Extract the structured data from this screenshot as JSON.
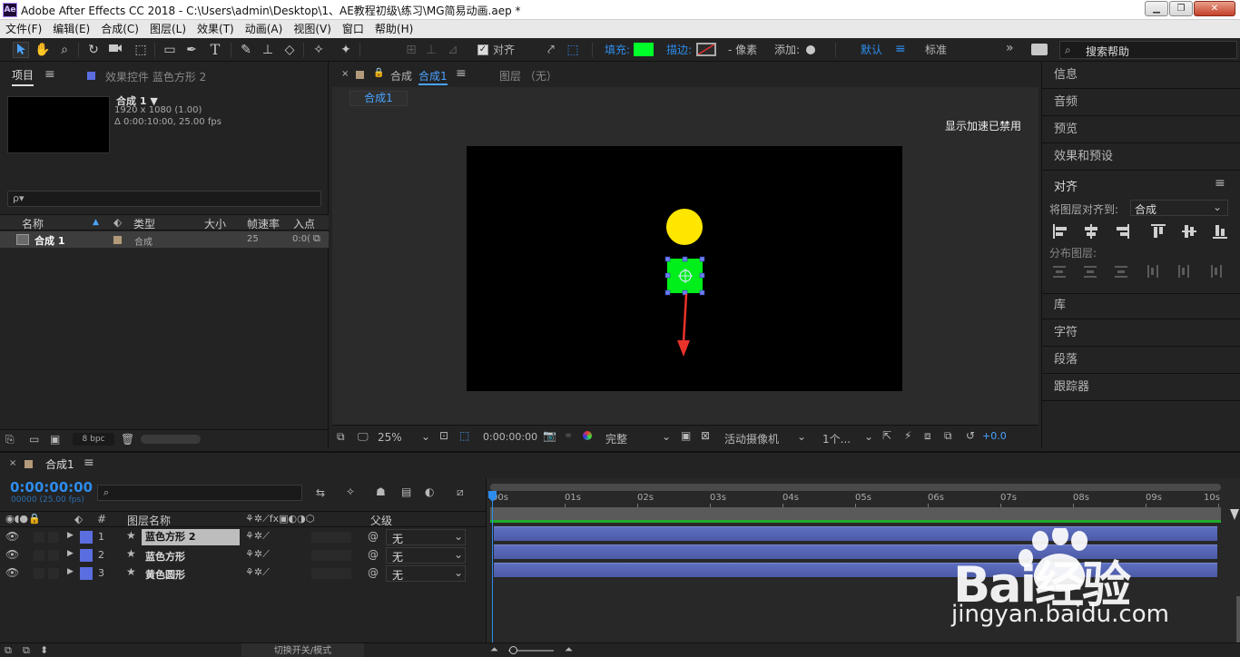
{
  "app": {
    "title": "Adobe After Effects CC 2018 - C:\\Users\\admin\\Desktop\\1、AE教程初级\\练习\\MG简易动画.aep *",
    "logo": "Ae"
  },
  "menu": [
    "文件(F)",
    "编辑(E)",
    "合成(C)",
    "图层(L)",
    "效果(T)",
    "动画(A)",
    "视图(V)",
    "窗口",
    "帮助(H)"
  ],
  "toolbar": {
    "align_label": "对齐",
    "fill_label": "填充:",
    "stroke_label": "描边:",
    "px_label": "- 像素",
    "add_label": "添加:",
    "workspace_default": "默认",
    "workspace_standard": "标准",
    "search_placeholder": "搜索帮助",
    "fill_color": "#00ff2a"
  },
  "project": {
    "tab_project": "项目",
    "tab_effects": "效果控件 蓝色方形 2",
    "comp_name": "合成 1 ▼",
    "comp_res": "1920 x 1080 (1.00)",
    "comp_dur": "Δ 0:00:10:00, 25.00 fps",
    "search_icon": "ρ▾",
    "col_name": "名称",
    "col_type": "类型",
    "col_size": "大小",
    "col_fps": "帧速率",
    "col_in": "入点",
    "row_name": "合成 1",
    "row_type": "合成",
    "row_fps": "25",
    "row_in": "0:0(",
    "bpc": "8 bpc"
  },
  "viewer": {
    "tab_label": "合成",
    "tab_comp": "合成1",
    "layer_tab": "图层 （无）",
    "sub_tab": "合成1",
    "gpu_notice": "显示加速已禁用",
    "zoom": "25%",
    "time": "0:00:00:00",
    "quality": "完整",
    "camera": "活动摄像机",
    "views": "1个...",
    "exposure": "+0.0",
    "circle_color": "#ffe600",
    "square_color": "#00ee1a",
    "arrow_color": "#e8322a"
  },
  "right_panel": {
    "info": "信息",
    "audio": "音频",
    "preview": "预览",
    "effects_presets": "效果和预设",
    "align": "对齐",
    "align_to_label": "将图层对齐到:",
    "align_to_value": "合成",
    "distribute": "分布图层:",
    "library": "库",
    "character": "字符",
    "paragraph": "段落",
    "tracker": "跟踪器"
  },
  "timeline": {
    "tab": "合成1",
    "timecode": "0:00:00:00",
    "frames": "00000 (25.00 fps)",
    "col_num": "#",
    "col_name": "图层名称",
    "col_parent": "父级",
    "switch_mode": "切换开关/模式",
    "ruler": [
      "00s",
      "01s",
      "02s",
      "03s",
      "04s",
      "05s",
      "06s",
      "07s",
      "08s",
      "09s",
      "10s"
    ],
    "layers": [
      {
        "num": "1",
        "name": "蓝色方形 2",
        "parent": "无"
      },
      {
        "num": "2",
        "name": "蓝色方形",
        "parent": "无"
      },
      {
        "num": "3",
        "name": "黄色圆形",
        "parent": "无"
      }
    ]
  },
  "watermark": {
    "brand": "Bai经验",
    "url": "jingyan.baidu.com"
  }
}
